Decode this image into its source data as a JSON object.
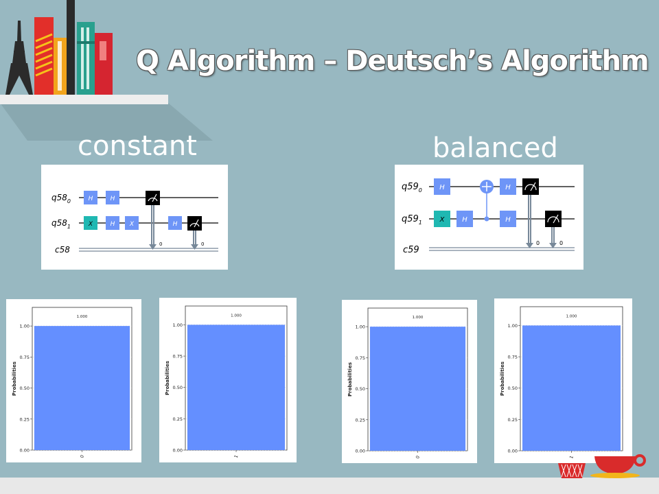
{
  "slide": {
    "title": "Q Algorithm – Deutsch’s Algorithm",
    "colors": {
      "background": "#98b8c1",
      "bar": "#648fff",
      "hadamard": "#6e95f7",
      "xgate": "#1fb8b2",
      "measure": "#000000",
      "shelf": "#e8e8e8"
    }
  },
  "constant": {
    "label": "constant",
    "circuit": {
      "qubits": [
        {
          "name": "q58",
          "index": "0"
        },
        {
          "name": "q58",
          "index": "1"
        }
      ],
      "classical": "c58",
      "gates_q0": [
        "H",
        "H"
      ],
      "gates_q1": [
        "X",
        "H",
        "X",
        "H"
      ],
      "measure_labels": [
        "0",
        "0"
      ]
    }
  },
  "balanced": {
    "label": "balanced",
    "circuit": {
      "qubits": [
        {
          "name": "q59",
          "index": "0"
        },
        {
          "name": "q59",
          "index": "1"
        }
      ],
      "classical": "c59",
      "gates_q0": [
        "H",
        "H"
      ],
      "gates_q1": [
        "X",
        "H",
        "H"
      ],
      "measure_labels": [
        "0",
        "0"
      ]
    }
  },
  "histograms": [
    {
      "ylabel": "Probabilities",
      "yticks": [
        "1.00",
        "0.75",
        "0.50",
        "0.25",
        "0.00"
      ]
    },
    {
      "ylabel": "Probabilities",
      "yticks": [
        "1.00",
        "0.75",
        "0.50",
        "0.25",
        "0.00"
      ]
    },
    {
      "ylabel": "Probabilities",
      "yticks": [
        "1.00",
        "0.75",
        "0.50",
        "0.25",
        "0.00"
      ]
    },
    {
      "ylabel": "Probabilities",
      "yticks": [
        "1.00",
        "0.75",
        "0.50",
        "0.25",
        "0.00"
      ]
    }
  ],
  "chart_data": [
    {
      "type": "bar",
      "categories": [
        "0"
      ],
      "values": [
        1.0
      ],
      "data_labels": [
        "1.000"
      ],
      "ylabel": "Probabilities",
      "ylim": [
        0,
        1.15
      ],
      "grid": true
    },
    {
      "type": "bar",
      "categories": [
        "1"
      ],
      "values": [
        1.0
      ],
      "data_labels": [
        "1.000"
      ],
      "ylabel": "Probabilities",
      "ylim": [
        0,
        1.15
      ],
      "grid": true
    },
    {
      "type": "bar",
      "categories": [
        "0"
      ],
      "values": [
        1.0
      ],
      "data_labels": [
        "1.000"
      ],
      "ylabel": "Probabilities",
      "ylim": [
        0,
        1.15
      ],
      "grid": true
    },
    {
      "type": "bar",
      "categories": [
        "1"
      ],
      "values": [
        1.0
      ],
      "data_labels": [
        "1.000"
      ],
      "ylabel": "Probabilities",
      "ylim": [
        0,
        1.15
      ],
      "grid": true
    }
  ]
}
